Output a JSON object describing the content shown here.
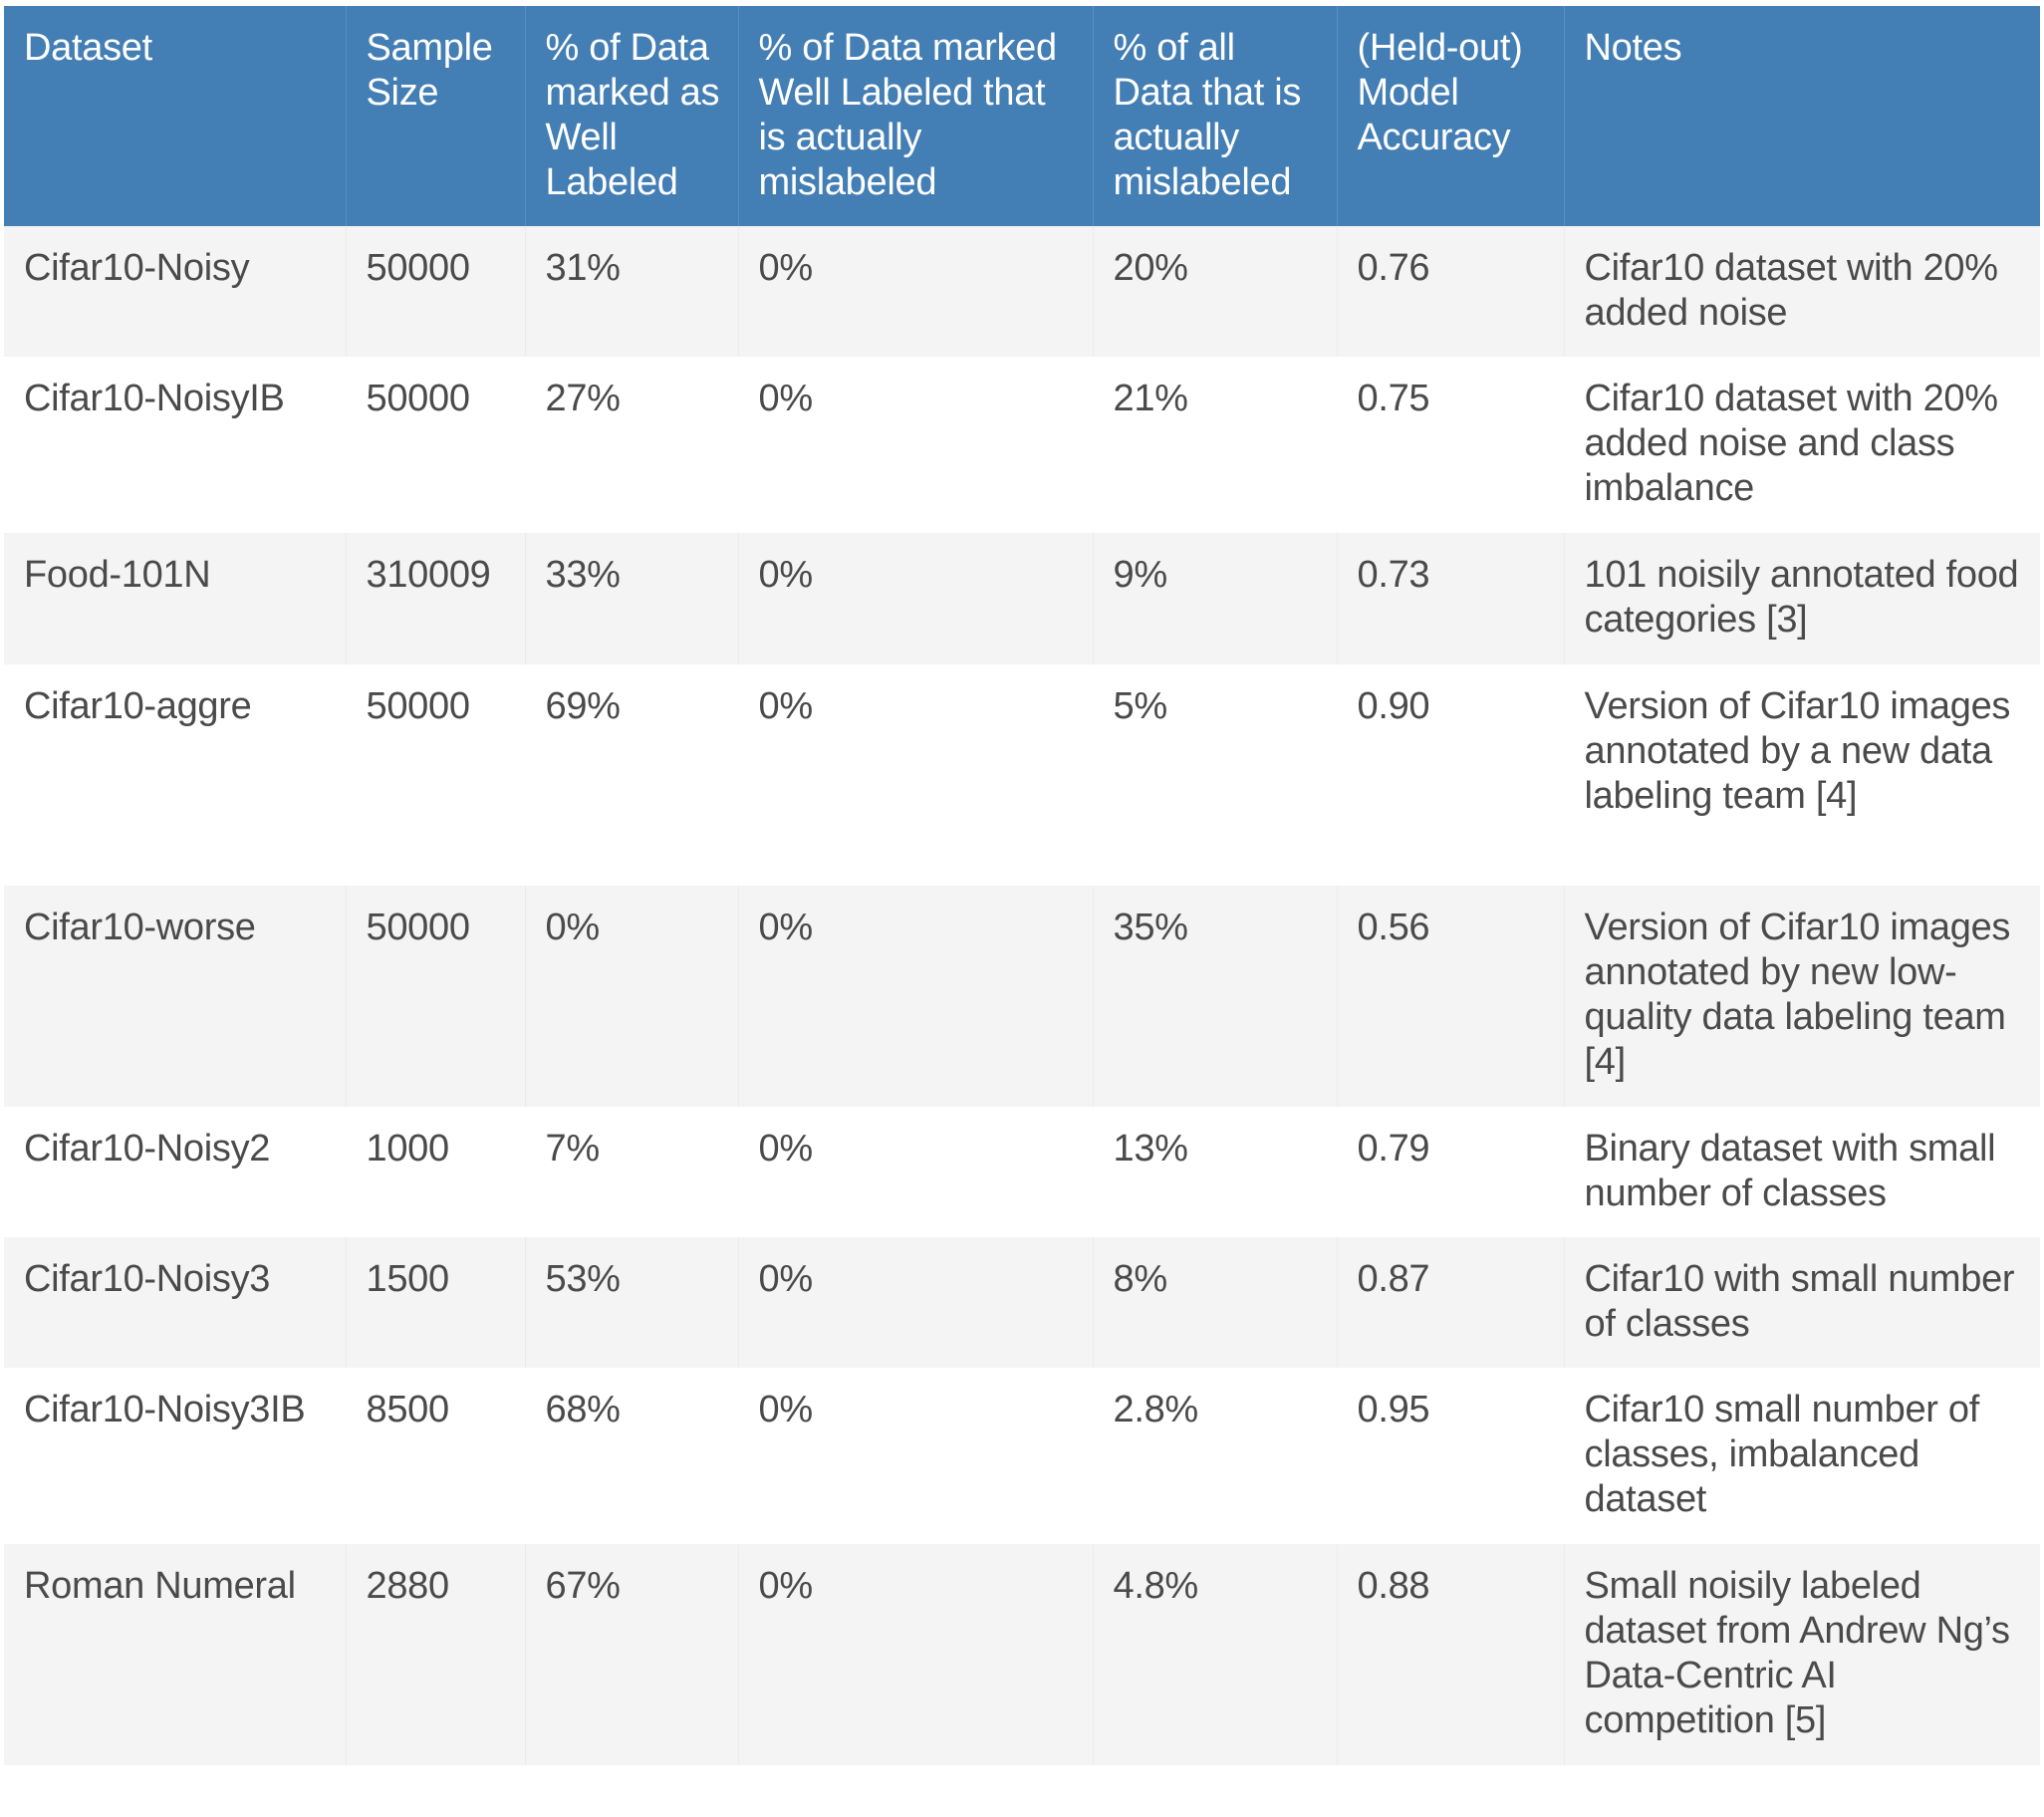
{
  "table": {
    "header_color": "#437eb4",
    "columns": [
      "Dataset",
      "Sample Size",
      "% of Data marked as Well Labeled",
      "% of Data marked Well Labeled that is actually mislabeled",
      "% of all Data that is actually mislabeled",
      "(Held-out) Model Accuracy",
      "Notes"
    ],
    "rows": [
      {
        "dataset": "Cifar10-Noisy",
        "sample_size": "50000",
        "pct_well_labeled": "31%",
        "pct_well_labeled_mislabeled": "0%",
        "pct_all_mislabeled": "20%",
        "accuracy": "0.76",
        "notes": "Cifar10 dataset with 20% added noise"
      },
      {
        "dataset": "Cifar10-NoisyIB",
        "sample_size": "50000",
        "pct_well_labeled": "27%",
        "pct_well_labeled_mislabeled": "0%",
        "pct_all_mislabeled": "21%",
        "accuracy": "0.75",
        "notes": "Cifar10 dataset with 20% added noise and class imbalance"
      },
      {
        "dataset": "Food-101N",
        "sample_size": "310009",
        "pct_well_labeled": "33%",
        "pct_well_labeled_mislabeled": "0%",
        "pct_all_mislabeled": "9%",
        "accuracy": "0.73",
        "notes": "101 noisily annotated food categories [3]"
      },
      {
        "dataset": "Cifar10-aggre",
        "sample_size": "50000",
        "pct_well_labeled": "69%",
        "pct_well_labeled_mislabeled": "0%",
        "pct_all_mislabeled": "5%",
        "accuracy": "0.90",
        "notes": "Version of Cifar10 images annotated by a new data labeling team [4]"
      },
      {
        "dataset": "Cifar10-worse",
        "sample_size": "50000",
        "pct_well_labeled": "0%",
        "pct_well_labeled_mislabeled": "0%",
        "pct_all_mislabeled": "35%",
        "accuracy": "0.56",
        "notes": "Version of Cifar10 images annotated by new low-quality data labeling team [4]"
      },
      {
        "dataset": "Cifar10-Noisy2",
        "sample_size": "1000",
        "pct_well_labeled": "7%",
        "pct_well_labeled_mislabeled": "0%",
        "pct_all_mislabeled": "13%",
        "accuracy": "0.79",
        "notes": "Binary dataset with small number of classes"
      },
      {
        "dataset": "Cifar10-Noisy3",
        "sample_size": "1500",
        "pct_well_labeled": "53%",
        "pct_well_labeled_mislabeled": "0%",
        "pct_all_mislabeled": "8%",
        "accuracy": "0.87",
        "notes": "Cifar10 with small number of classes"
      },
      {
        "dataset": "Cifar10-Noisy3IB",
        "sample_size": "8500",
        "pct_well_labeled": "68%",
        "pct_well_labeled_mislabeled": "0%",
        "pct_all_mislabeled": "2.8%",
        "accuracy": "0.95",
        "notes": "Cifar10 small number of classes, imbalanced dataset"
      },
      {
        "dataset": "Roman Numeral",
        "sample_size": "2880",
        "pct_well_labeled": "67%",
        "pct_well_labeled_mislabeled": "0%",
        "pct_all_mislabeled": "4.8%",
        "accuracy": "0.88",
        "notes": "Small noisily labeled dataset from Andrew Ng’s Data-Centric AI competition [5]"
      }
    ]
  }
}
